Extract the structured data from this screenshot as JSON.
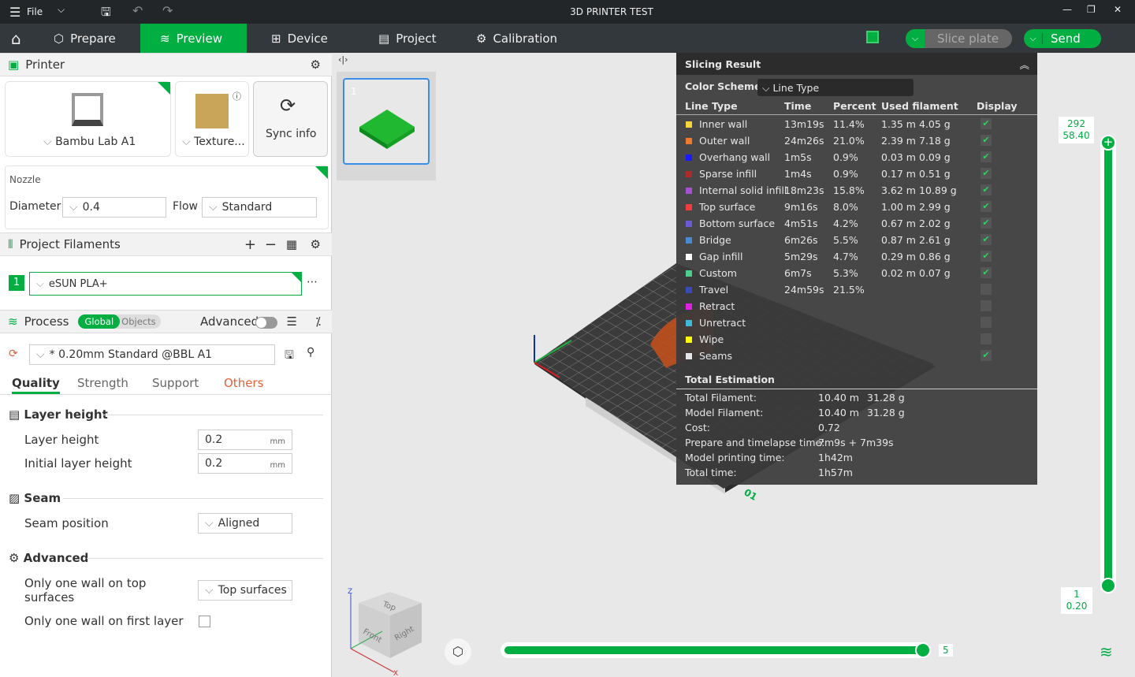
{
  "window": {
    "title": "3D PRINTER TEST",
    "file_label": "File"
  },
  "nav": {
    "tabs": [
      "Prepare",
      "Preview",
      "Device",
      "Project",
      "Calibration"
    ],
    "active": "Preview",
    "slice_label": "Slice plate",
    "send_label": "Send"
  },
  "printer": {
    "section": "Printer",
    "name": "Bambu Lab A1",
    "plate": "Texture...",
    "sync": "Sync info",
    "nozzle_label": "Nozzle",
    "diameter_label": "Diameter",
    "diameter": "0.4",
    "flow_label": "Flow",
    "flow": "Standard"
  },
  "filaments": {
    "section": "Project Filaments",
    "items": [
      {
        "index": "1",
        "name": "eSUN PLA+",
        "color": "#00ae42"
      }
    ]
  },
  "process": {
    "section": "Process",
    "global": "Global",
    "objects": "Objects",
    "advanced": "Advanced",
    "advanced_on": false,
    "preset": "* 0.20mm Standard @BBL A1",
    "tabs": [
      "Quality",
      "Strength",
      "Support",
      "Others"
    ],
    "active_tab": "Quality",
    "groups": {
      "layer": "Layer height",
      "seam": "Seam",
      "advanced": "Advanced"
    },
    "layer_height_label": "Layer height",
    "layer_height": "0.2",
    "initial_layer_label": "Initial layer height",
    "initial_layer": "0.2",
    "unit": "mm",
    "seam_label": "Seam position",
    "seam": "Aligned",
    "one_wall_top_label": "Only one wall on top surfaces",
    "one_wall_top": "Top surfaces",
    "one_wall_first_label": "Only one wall on first layer",
    "one_wall_first": false
  },
  "plate_thumb": {
    "number": "1"
  },
  "result": {
    "title": "Slicing Result",
    "scheme_label": "Color Scheme",
    "scheme": "Line Type",
    "headers": [
      "Line Type",
      "Time",
      "Percent",
      "Used filament",
      "Display"
    ],
    "rows": [
      {
        "name": "Inner wall",
        "color": "#f5d63a",
        "time": "13m19s",
        "percent": "11.4%",
        "length": "1.35 m",
        "weight": "4.05 g",
        "display": true
      },
      {
        "name": "Outer wall",
        "color": "#f07a2c",
        "time": "24m26s",
        "percent": "21.0%",
        "length": "2.39 m",
        "weight": "7.18 g",
        "display": true
      },
      {
        "name": "Overhang wall",
        "color": "#1a1aff",
        "time": "1m5s",
        "percent": "0.9%",
        "length": "0.03 m",
        "weight": "0.09 g",
        "display": true
      },
      {
        "name": "Sparse infill",
        "color": "#b02a2a",
        "time": "1m4s",
        "percent": "0.9%",
        "length": "0.17 m",
        "weight": "0.51 g",
        "display": true
      },
      {
        "name": "Internal solid infill",
        "color": "#a452d4",
        "time": "18m23s",
        "percent": "15.8%",
        "length": "3.62 m",
        "weight": "10.89 g",
        "display": true
      },
      {
        "name": "Top surface",
        "color": "#f03c3c",
        "time": "9m16s",
        "percent": "8.0%",
        "length": "1.00 m",
        "weight": "2.99 g",
        "display": true
      },
      {
        "name": "Bottom surface",
        "color": "#6a5ad4",
        "time": "4m51s",
        "percent": "4.2%",
        "length": "0.67 m",
        "weight": "2.02 g",
        "display": true
      },
      {
        "name": "Bridge",
        "color": "#4a8ad4",
        "time": "6m26s",
        "percent": "5.5%",
        "length": "0.87 m",
        "weight": "2.61 g",
        "display": true
      },
      {
        "name": "Gap infill",
        "color": "#ffffff",
        "time": "5m29s",
        "percent": "4.7%",
        "length": "0.29 m",
        "weight": "0.86 g",
        "display": true
      },
      {
        "name": "Custom",
        "color": "#4ccf8a",
        "time": "6m7s",
        "percent": "5.3%",
        "length": "0.02 m",
        "weight": "0.07 g",
        "display": true
      },
      {
        "name": "Travel",
        "color": "#3c4ab4",
        "time": "24m59s",
        "percent": "21.5%",
        "length": "",
        "weight": "",
        "display": false
      },
      {
        "name": "Retract",
        "color": "#e020e0",
        "time": "",
        "percent": "",
        "length": "",
        "weight": "",
        "display": false
      },
      {
        "name": "Unretract",
        "color": "#40b8d8",
        "time": "",
        "percent": "",
        "length": "",
        "weight": "",
        "display": false
      },
      {
        "name": "Wipe",
        "color": "#ffff00",
        "time": "",
        "percent": "",
        "length": "",
        "weight": "",
        "display": false
      },
      {
        "name": "Seams",
        "color": "#e6e6e6",
        "time": "",
        "percent": "",
        "length": "",
        "weight": "",
        "display": true
      }
    ],
    "total_title": "Total Estimation",
    "totals": [
      {
        "label": "Total Filament:",
        "value": "10.40 m",
        "value2": "31.28 g"
      },
      {
        "label": "Model Filament:",
        "value": "10.40 m",
        "value2": "31.28 g"
      },
      {
        "label": "Cost:",
        "value": "0.72",
        "value2": ""
      },
      {
        "label": "Prepare and timelapse time:",
        "value": "7m9s + 7m39s",
        "value2": ""
      },
      {
        "label": "Model printing time:",
        "value": "1h42m",
        "value2": ""
      },
      {
        "label": "Total time:",
        "value": "1h57m",
        "value2": ""
      }
    ]
  },
  "layer_slider": {
    "top_layer": "292",
    "top_height": "58.40",
    "bottom_layer": "1",
    "bottom_height": "0.20"
  },
  "move_slider": {
    "value": "5"
  },
  "cube": {
    "top": "Top",
    "front": "Front",
    "right": "Right",
    "z": "Z",
    "x": "X"
  },
  "plate_label": "01"
}
